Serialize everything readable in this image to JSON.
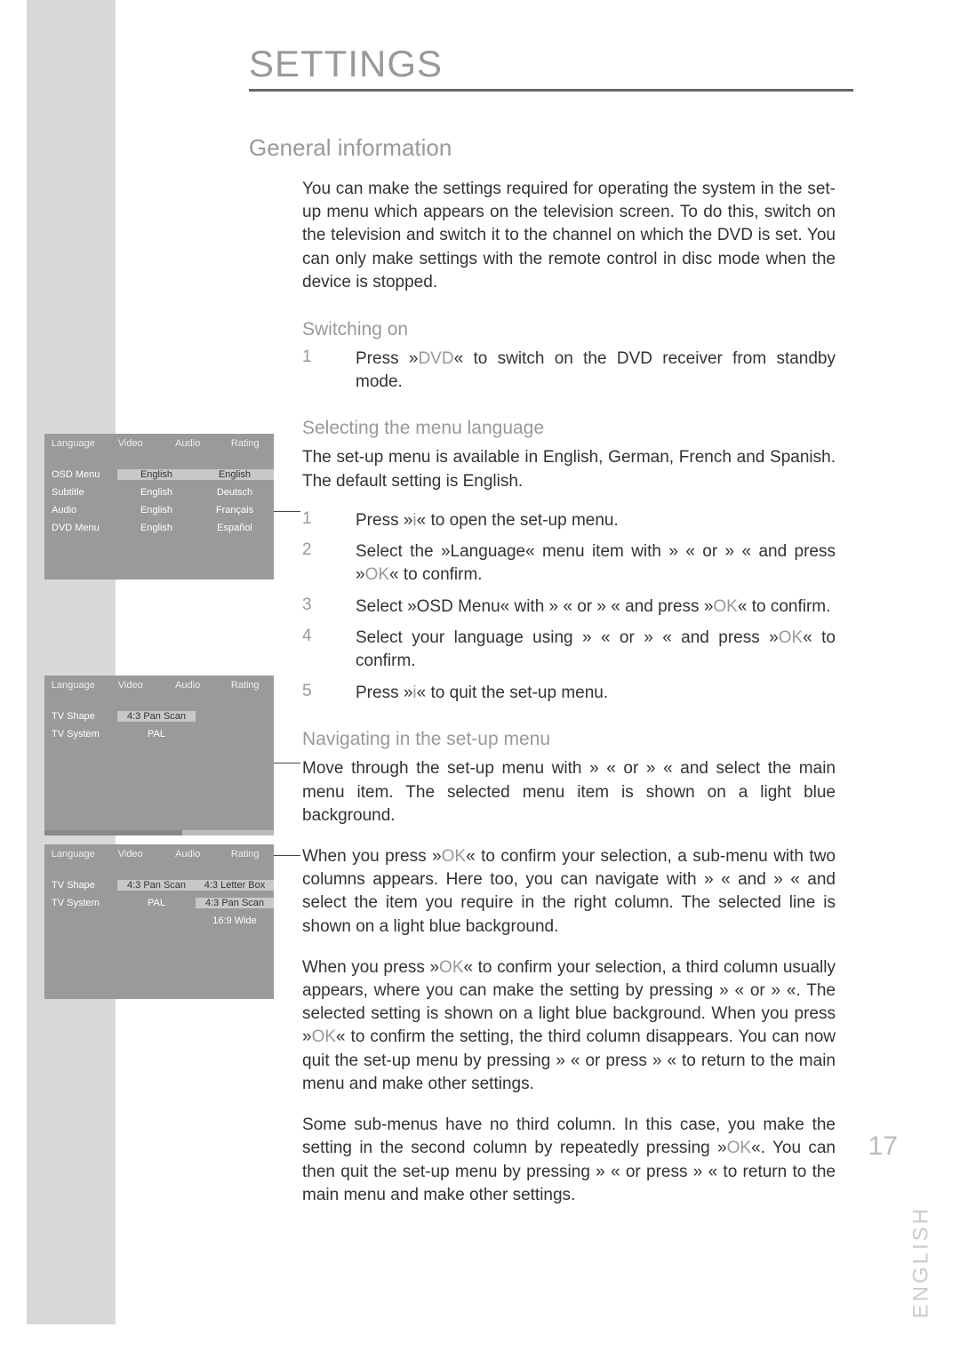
{
  "header": {
    "title": "SETTINGS"
  },
  "sections": {
    "general": {
      "heading": "General information",
      "intro": "You can make the settings required for operating the system in the set-up menu which appears on the television screen. To do this, switch on the television and switch it to the channel on which the DVD is set. You can only make settings with the remote control in disc mode when the device is stopped."
    },
    "switching": {
      "heading": "Switching on",
      "step1_num": "1",
      "step1a": "Press »",
      "step1_key": "DVD",
      "step1b": "« to switch on the DVD receiver from standby mode."
    },
    "menulang": {
      "heading": "Selecting the menu language",
      "intro": "The set-up menu is available in English, German, French and Spanish. The default setting is English.",
      "s1_num": "1",
      "s1a": "Press »",
      "s1_key": "i",
      "s1b": "« to open the set-up menu.",
      "s2_num": "2",
      "s2a": "Select the »Language« menu item with » « or »   « and press »",
      "s2_key": "OK",
      "s2b": "« to confirm.",
      "s3_num": "3",
      "s3a": "Select »OSD Menu« with »   « or »   « and press »",
      "s3_key": "OK",
      "s3b": "« to confirm.",
      "s4_num": "4",
      "s4a": "Select your language using » « or »   « and press »",
      "s4_key": "OK",
      "s4b": "« to confirm.",
      "s5_num": "5",
      "s5a": "Press »",
      "s5_key": "i",
      "s5b": "« to quit the set-up menu."
    },
    "nav": {
      "heading": "Navigating in the set-up menu",
      "p1": "Move through the set-up menu with » « or »   « and select the main menu item. The selected menu item is shown on a light blue background.",
      "p2a": "When you press »",
      "p2_key1": "OK",
      "p2b": "« to confirm your selection, a sub-menu with two columns appears. Here too, you can navigate with » « and »   « and select the item you require in the right column. The selected line is shown on a light blue background.",
      "p3a": "When you press »",
      "p3_key1": "OK",
      "p3b": "« to confirm your selection, a third column usually appears, where you can make the setting by pressing » « or »   «. The selected setting is shown on a light blue background. When you press »",
      "p3_key2": "OK",
      "p3c": "« to confirm the setting, the third column disappears. You can now quit the set-up menu by pressing » « or press »   « to return to the main menu and make other settings.",
      "p4a": "Some sub-menus have no third column. In this case, you make the setting in the second column by repeatedly pressing »",
      "p4_key": "OK",
      "p4b": "«. You can then quit the set-up menu by pressing » « or press »   « to return to the main menu and make other settings."
    }
  },
  "panel1": {
    "tabs": [
      "Language",
      "Video",
      "Audio",
      "Rating"
    ],
    "rows": [
      {
        "left": "OSD Menu",
        "mid": "English",
        "right": "English",
        "midSel": true,
        "rightSel": true
      },
      {
        "left": "Subtitle",
        "mid": "English",
        "right": "Deutsch"
      },
      {
        "left": "Audio",
        "mid": "English",
        "right": "Français"
      },
      {
        "left": "DVD Menu",
        "mid": "English",
        "right": "Español"
      }
    ]
  },
  "panel2": {
    "tabs": [
      "Language",
      "Video",
      "Audio",
      "Rating"
    ],
    "rows": [
      {
        "left": "TV Shape",
        "mid": "4:3 Pan Scan",
        "midSel": true
      },
      {
        "left": "TV System",
        "mid": "PAL"
      }
    ]
  },
  "panel3": {
    "tabs": [
      "Language",
      "Video",
      "Audio",
      "Rating"
    ],
    "rows": [
      {
        "left": "TV Shape",
        "mid": "4:3 Pan Scan",
        "right": "4:3 Letter Box",
        "midSel": true,
        "rightSel": true
      },
      {
        "left": "TV System",
        "mid": "PAL",
        "right": "4:3 Pan Scan",
        "rightSel": true
      },
      {
        "left": "",
        "mid": "",
        "right": "16:9 Wide"
      }
    ]
  },
  "side": {
    "lang": "ENGLISH",
    "page": "17"
  }
}
